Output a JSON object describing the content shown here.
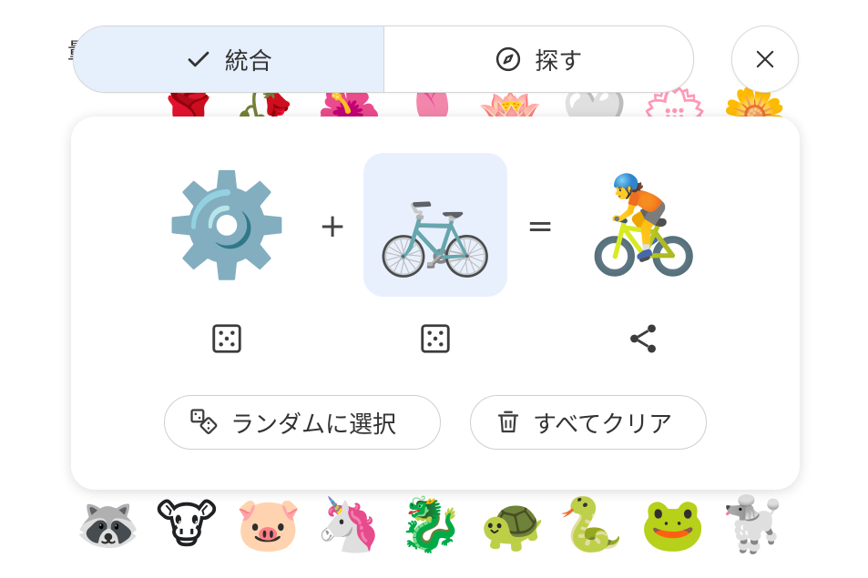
{
  "top_partial_char": "量",
  "segmented": {
    "merge_label": "統合",
    "explore_label": "探す",
    "active": "merge"
  },
  "combo": {
    "left_emoji": "⚙️",
    "plus": "+",
    "right_emoji": "🚲",
    "equals": "=",
    "result_emoji": "🚴"
  },
  "actions": {
    "random_label": "ランダムに選択",
    "clear_label": "すべてクリア"
  },
  "background": {
    "top_row": [
      "🌹",
      "🥀",
      "🌺",
      "🌷",
      "🪷",
      "🤍",
      "💮",
      "🌼"
    ],
    "bottom_row": [
      "🦝",
      "🐮",
      "🐷",
      "🦄",
      "🐉",
      "🐢",
      "🐍",
      "🐸",
      "🐩"
    ]
  }
}
